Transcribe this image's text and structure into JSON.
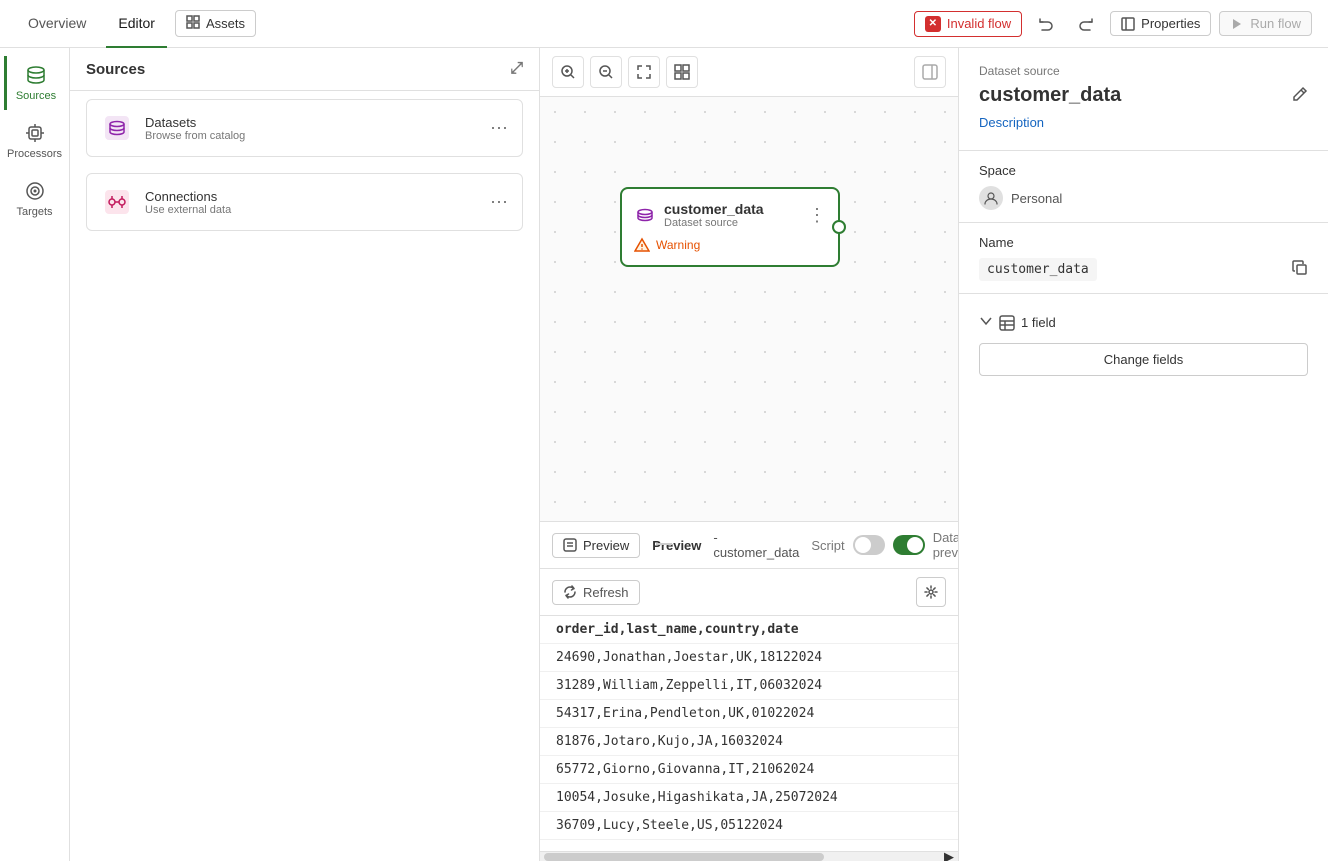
{
  "topNav": {
    "overview_label": "Overview",
    "editor_label": "Editor",
    "assets_label": "Assets",
    "invalid_flow_label": "Invalid flow",
    "undo_icon": "↩",
    "redo_icon": "↪",
    "properties_label": "Properties",
    "run_flow_label": "Run flow"
  },
  "sidebar": {
    "sources_label": "Sources",
    "processors_label": "Processors",
    "targets_label": "Targets"
  },
  "sourcesPanel": {
    "title": "Sources",
    "collapse_icon": "⤢",
    "datasets_title": "Datasets",
    "datasets_sub": "Browse from catalog",
    "connections_title": "Connections",
    "connections_sub": "Use external data"
  },
  "canvas": {
    "zoom_in": "+",
    "zoom_out": "−",
    "fit": "⤢",
    "grid": "⊞"
  },
  "flowNode": {
    "title": "customer_data",
    "subtitle": "Dataset source",
    "warning_label": "Warning",
    "more_icon": "⋮"
  },
  "preview": {
    "preview_btn_label": "Preview",
    "title": "Preview",
    "subtitle": "- customer_data",
    "script_label": "Script",
    "data_preview_label": "Data preview",
    "refresh_label": "Refresh",
    "data": [
      "order_id,last_name,country,date",
      "24690,Jonathan,Joestar,UK,18122024",
      "31289,William,Zeppelli,IT,06032024",
      "54317,Erina,Pendleton,UK,01022024",
      "81876,Jotaro,Kujo,JA,16032024",
      "65772,Giorno,Giovanna,IT,21062024",
      "10054,Josuke,Higashikata,JA,25072024",
      "36709,Lucy,Steele,US,05122024"
    ]
  },
  "rightPanel": {
    "dataset_source_label": "Dataset source",
    "dataset_name": "customer_data",
    "description_label": "Description",
    "space_label": "Space",
    "space_value": "Personal",
    "name_label": "Name",
    "name_value": "customer_data",
    "fields_count_label": "1 field",
    "change_fields_label": "Change fields"
  }
}
